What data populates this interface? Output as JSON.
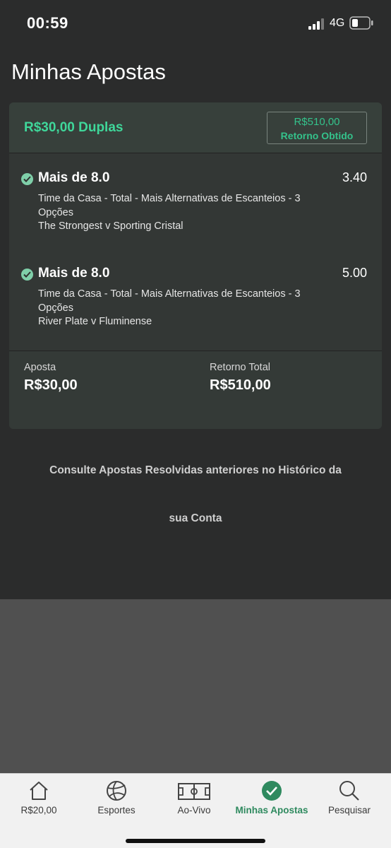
{
  "status_bar": {
    "time": "00:59",
    "network": "4G",
    "icons": [
      "signal-icon",
      "battery-icon"
    ]
  },
  "page": {
    "title": "Minhas Apostas"
  },
  "bet": {
    "stake_type": "R$30,00 Duplas",
    "return_amount": "R$510,00",
    "return_label": "Retorno Obtido",
    "selections": [
      {
        "name": "Mais de 8.0",
        "odds": "3.40",
        "market": "Time da Casa - Total - Mais Alternativas de Escanteios - 3 Opções",
        "event": "The Strongest v Sporting Cristal",
        "status_icon": "check-circle-icon"
      },
      {
        "name": "Mais de 8.0",
        "odds": "5.00",
        "market": "Time da Casa - Total - Mais Alternativas de Escanteios - 3 Opções",
        "event": "River Plate v Fluminense",
        "status_icon": "check-circle-icon"
      }
    ],
    "footer": {
      "stake_label": "Aposta",
      "stake_value": "R$30,00",
      "total_return_label": "Retorno Total",
      "total_return_value": "R$510,00"
    }
  },
  "history_note": {
    "line1": "Consulte Apostas Resolvidas anteriores no Histórico da",
    "line2": "sua Conta"
  },
  "tab_bar": {
    "tabs": [
      {
        "label": "R$20,00",
        "icon": "home-icon",
        "active": false
      },
      {
        "label": "Esportes",
        "icon": "volleyball-icon",
        "active": false
      },
      {
        "label": "Ao-Vivo",
        "icon": "pitch-icon",
        "active": false
      },
      {
        "label": "Minhas Apostas",
        "icon": "check-circle-icon",
        "active": true
      },
      {
        "label": "Pesquisar",
        "icon": "search-icon",
        "active": false
      }
    ]
  },
  "colors": {
    "background": "#2b2c2c",
    "accent_green": "#3fd79a",
    "active_tab": "#2f8a5f"
  }
}
